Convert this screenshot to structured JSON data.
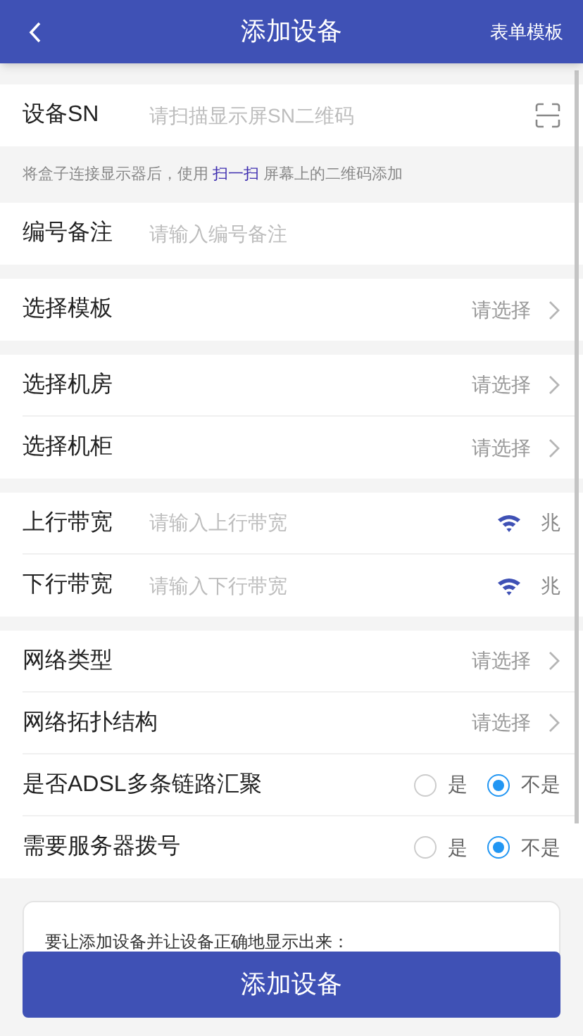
{
  "header": {
    "title": "添加设备",
    "action": "表单模板"
  },
  "groups": [
    {
      "rows": [
        {
          "kind": "scan",
          "label": "设备SN",
          "placeholder": "请扫描显示屏SN二维码"
        }
      ],
      "hint": {
        "before": "将盒子连接显示器后，使用",
        "link": "扫一扫",
        "after": "屏幕上的二维码添加"
      }
    },
    {
      "rows": [
        {
          "kind": "input",
          "label": "编号备注",
          "placeholder": "请输入编号备注"
        }
      ]
    },
    {
      "rows": [
        {
          "kind": "select",
          "label": "选择模板",
          "value": "请选择"
        }
      ]
    },
    {
      "rows": [
        {
          "kind": "select",
          "label": "选择机房",
          "value": "请选择"
        },
        {
          "kind": "select",
          "label": "选择机柜",
          "value": "请选择"
        }
      ]
    },
    {
      "rows": [
        {
          "kind": "bandwidth",
          "label": "上行带宽",
          "placeholder": "请输入上行带宽",
          "unit": "兆"
        },
        {
          "kind": "bandwidth",
          "label": "下行带宽",
          "placeholder": "请输入下行带宽",
          "unit": "兆"
        }
      ]
    },
    {
      "rows": [
        {
          "kind": "select",
          "label": "网络类型",
          "value": "请选择"
        },
        {
          "kind": "select",
          "label": "网络拓扑结构",
          "value": "请选择"
        },
        {
          "kind": "radio",
          "label": "是否ADSL多条链路汇聚",
          "options": [
            {
              "label": "是",
              "selected": false
            },
            {
              "label": "不是",
              "selected": true
            }
          ]
        },
        {
          "kind": "radio",
          "label": "需要服务器拨号",
          "options": [
            {
              "label": "是",
              "selected": false
            },
            {
              "label": "不是",
              "selected": true
            }
          ]
        }
      ]
    }
  ],
  "notice": {
    "text": "要让添加设备并让设备正确地显示出来："
  },
  "submit": {
    "label": "添加设备"
  }
}
